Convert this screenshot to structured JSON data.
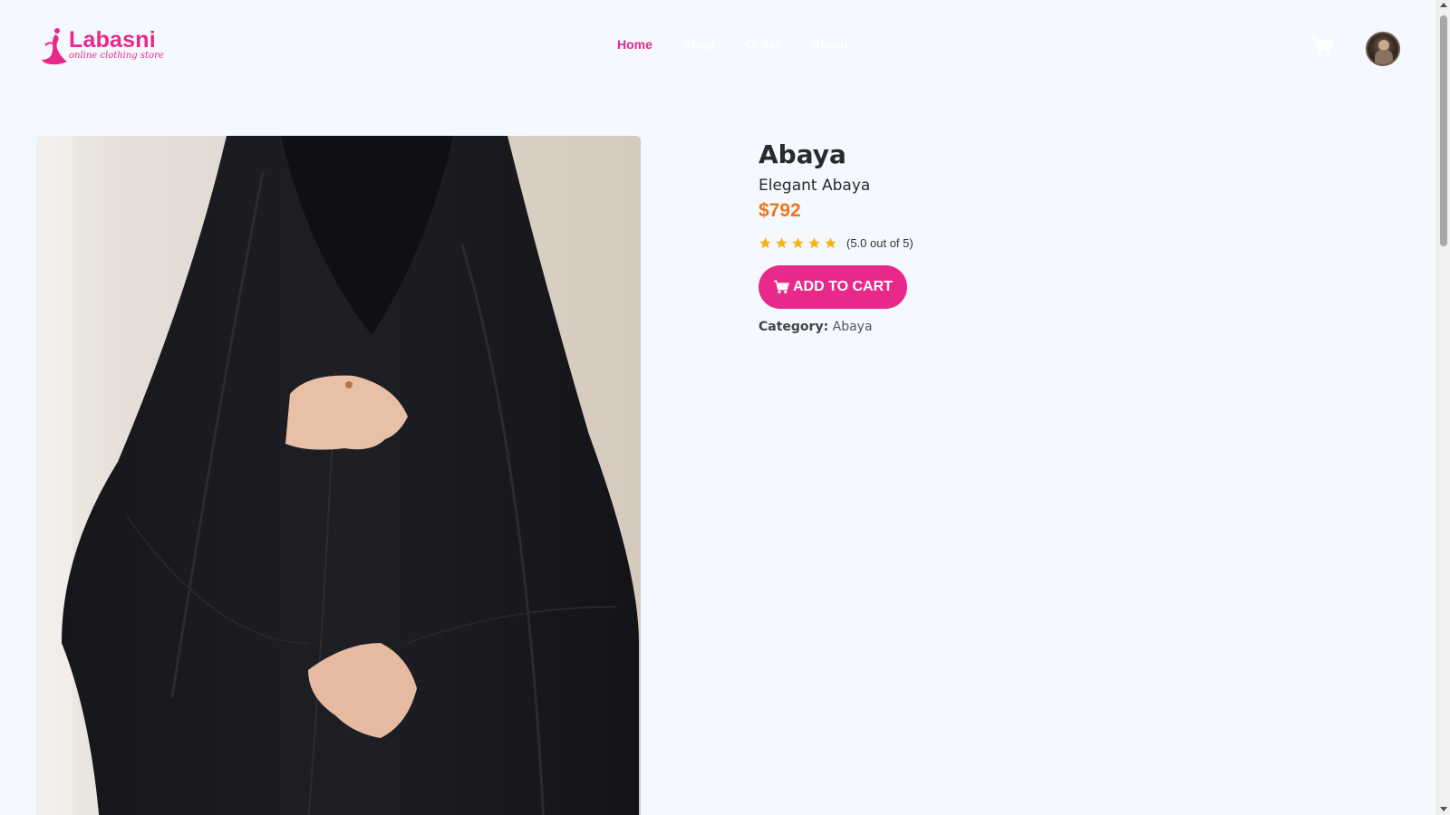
{
  "brand": {
    "name": "Labasni",
    "tagline": "online clothing store",
    "accent_color": "#e8288a"
  },
  "nav": {
    "items": [
      {
        "label": "Home",
        "active": true
      },
      {
        "label": "Shop",
        "active": false
      },
      {
        "label": "Order",
        "active": false
      },
      {
        "label": "About",
        "active": false
      }
    ]
  },
  "header_icons": {
    "cart": "shopping-cart-icon",
    "avatar": "user-avatar"
  },
  "product": {
    "title": "Abaya",
    "subtitle": "Elegant Abaya",
    "price": "$792",
    "price_color": "#e8781e",
    "rating_value": 5,
    "rating_max": 5,
    "rating_text": "(5.0 out of 5)",
    "star_color": "#f5b50a",
    "add_to_cart_label": "ADD TO CART",
    "category_label": "Category:",
    "category_value": "Abaya"
  }
}
